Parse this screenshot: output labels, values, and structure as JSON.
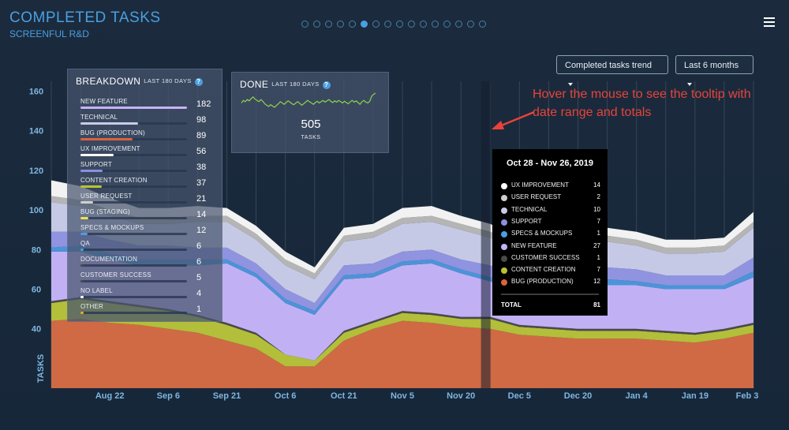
{
  "header": {
    "title": "COMPLETED TASKS",
    "subtitle": "SCREENFUL R&D",
    "page_dots": 16,
    "active_dot": 5,
    "dropdown_trend": "Completed tasks trend",
    "dropdown_range": "Last 6 months"
  },
  "breakdown": {
    "title": "BREAKDOWN",
    "subtitle": "LAST 180 DAYS",
    "help": "?",
    "items": [
      {
        "label": "NEW FEATURE",
        "count": 182,
        "color": "#c5b3f7"
      },
      {
        "label": "TECHNICAL",
        "count": 98,
        "color": "#c8cbe8"
      },
      {
        "label": "BUG (PRODUCTION)",
        "count": 89,
        "color": "#d9633f"
      },
      {
        "label": "UX IMPROVEMENT",
        "count": 56,
        "color": "#ffffff"
      },
      {
        "label": "SUPPORT",
        "count": 38,
        "color": "#8c8fe2"
      },
      {
        "label": "CONTENT CREATION",
        "count": 37,
        "color": "#b9c234"
      },
      {
        "label": "USER REQUEST",
        "count": 21,
        "color": "#cfcfcf"
      },
      {
        "label": "BUG (STAGING)",
        "count": 14,
        "color": "#f1e14a"
      },
      {
        "label": "SPECS & MOCKUPS",
        "count": 12,
        "color": "#4a9fe0"
      },
      {
        "label": "QA",
        "count": 6,
        "color": "#4a9fe0"
      },
      {
        "label": "DOCUMENTATION",
        "count": 6,
        "color": "#4a4a4a"
      },
      {
        "label": "CUSTOMER SUCCESS",
        "count": 5,
        "color": "#4a4a4a"
      },
      {
        "label": "NO LABEL",
        "count": 4,
        "color": "#ffffff"
      },
      {
        "label": "OTHER",
        "count": 1,
        "color": "#f0a63a"
      }
    ]
  },
  "done": {
    "title": "DONE",
    "subtitle": "LAST 180 DAYS",
    "help": "?",
    "value": "505",
    "unit": "TASKS",
    "sparkline": [
      52,
      58,
      55,
      60,
      57,
      62,
      66,
      61,
      58,
      55,
      60,
      56,
      50,
      47,
      44,
      48,
      45,
      42,
      46,
      50,
      55,
      52,
      49,
      53,
      57,
      54,
      50,
      48,
      52,
      55,
      51,
      47,
      50,
      54,
      58,
      55,
      52,
      49,
      53,
      56,
      52,
      55,
      58,
      54,
      57,
      60,
      56,
      53,
      57,
      54,
      58,
      55,
      52,
      56,
      53,
      50,
      55,
      58,
      54,
      57,
      53,
      49,
      55,
      58,
      54,
      52,
      56,
      68,
      72,
      75
    ]
  },
  "annotation": "Hover the mouse to see the tooltip with date range and totals",
  "tooltip": {
    "title": "Oct 28 - Nov 26, 2019",
    "rows": [
      {
        "name": "UX IMPROVEMENT",
        "value": 14,
        "color": "#ffffff"
      },
      {
        "name": "USER REQUEST",
        "value": 2,
        "color": "#cfcfcf"
      },
      {
        "name": "TECHNICAL",
        "value": 10,
        "color": "#c8cbe8"
      },
      {
        "name": "SUPPORT",
        "value": 7,
        "color": "#8c8fe2"
      },
      {
        "name": "SPECS & MOCKUPS",
        "value": 1,
        "color": "#4a9fe0"
      },
      {
        "name": "NEW FEATURE",
        "value": 27,
        "color": "#c5b3f7"
      },
      {
        "name": "CUSTOMER SUCCESS",
        "value": 1,
        "color": "#4a4a4a"
      },
      {
        "name": "CONTENT CREATION",
        "value": 7,
        "color": "#b9c234"
      },
      {
        "name": "BUG (PRODUCTION)",
        "value": 12,
        "color": "#d9633f"
      }
    ],
    "total_label": "TOTAL",
    "total_value": 81
  },
  "chart_data": {
    "type": "area",
    "stacked": true,
    "ylabel": "TASKS",
    "ylim": [
      10,
      165
    ],
    "yticks": [
      40,
      60,
      80,
      100,
      120,
      140,
      160
    ],
    "x": [
      "Aug 8",
      "Aug 15",
      "Aug 22",
      "Aug 29",
      "Sep 6",
      "Sep 13",
      "Sep 21",
      "Sep 28",
      "Oct 6",
      "Oct 13",
      "Oct 21",
      "Oct 28",
      "Nov 5",
      "Nov 12",
      "Nov 20",
      "Nov 27",
      "Dec 5",
      "Dec 12",
      "Dec 20",
      "Dec 27",
      "Jan 4",
      "Jan 11",
      "Jan 19",
      "Jan 26",
      "Feb 3"
    ],
    "xticks": [
      "Aug 22",
      "Sep 6",
      "Sep 21",
      "Oct 6",
      "Oct 21",
      "Nov 5",
      "Nov 20",
      "Dec 5",
      "Dec 20",
      "Jan 4",
      "Jan 19",
      "Feb 3"
    ],
    "xtick_index": [
      2,
      4,
      6,
      8,
      10,
      12,
      14,
      16,
      18,
      20,
      22,
      24
    ],
    "grid": true,
    "legend": "none",
    "series": [
      {
        "name": "BUG (PRODUCTION)",
        "color": "#cf6a45",
        "values": [
          34,
          35,
          33,
          32,
          30,
          28,
          24,
          20,
          11,
          11,
          24,
          30,
          34,
          33,
          31,
          30,
          27,
          26,
          25,
          25,
          25,
          24,
          23,
          25,
          28
        ]
      },
      {
        "name": "CONTENT CREATION",
        "color": "#b3be3a",
        "values": [
          9,
          10,
          10,
          9,
          9,
          8,
          8,
          7,
          6,
          3,
          4,
          3,
          4,
          4,
          4,
          5,
          4,
          4,
          4,
          4,
          4,
          4,
          4,
          4,
          4
        ]
      },
      {
        "name": "CUSTOMER SUCCESS",
        "color": "#4a4a4a",
        "values": [
          1,
          1,
          1,
          1,
          1,
          1,
          1,
          1,
          0,
          0,
          1,
          1,
          1,
          1,
          1,
          1,
          1,
          1,
          1,
          1,
          1,
          1,
          1,
          1,
          1
        ]
      },
      {
        "name": "NEW FEATURE",
        "color": "#c2b0f5",
        "values": [
          25,
          23,
          21,
          20,
          22,
          25,
          30,
          28,
          26,
          23,
          26,
          22,
          23,
          25,
          22,
          18,
          16,
          20,
          23,
          22,
          22,
          21,
          22,
          20,
          23
        ]
      },
      {
        "name": "SPECS & MOCKUPS",
        "color": "#4b94d8",
        "values": [
          2,
          3,
          3,
          3,
          3,
          3,
          2,
          2,
          2,
          2,
          2,
          2,
          2,
          2,
          2,
          2,
          3,
          2,
          2,
          3,
          2,
          2,
          2,
          2,
          3
        ]
      },
      {
        "name": "SUPPORT",
        "color": "#8f93e0",
        "values": [
          8,
          7,
          7,
          7,
          7,
          6,
          6,
          5,
          5,
          4,
          5,
          5,
          5,
          5,
          5,
          6,
          5,
          5,
          5,
          6,
          6,
          5,
          5,
          5,
          7
        ]
      },
      {
        "name": "TECHNICAL",
        "color": "#c6c9e6",
        "values": [
          15,
          13,
          12,
          11,
          11,
          13,
          13,
          12,
          12,
          12,
          12,
          13,
          14,
          14,
          15,
          14,
          13,
          12,
          12,
          13,
          12,
          11,
          11,
          12,
          15
        ]
      },
      {
        "name": "USER REQUEST",
        "color": "#b5b5b5",
        "values": [
          3,
          3,
          3,
          3,
          3,
          3,
          3,
          3,
          3,
          3,
          3,
          3,
          3,
          3,
          3,
          3,
          3,
          3,
          3,
          3,
          3,
          3,
          3,
          3,
          3
        ]
      },
      {
        "name": "UX IMPROVEMENT",
        "color": "#f2f2f2",
        "values": [
          8,
          7,
          6,
          5,
          5,
          5,
          4,
          4,
          4,
          3,
          4,
          4,
          5,
          5,
          4,
          4,
          4,
          4,
          4,
          4,
          4,
          4,
          4,
          4,
          5
        ]
      }
    ]
  }
}
